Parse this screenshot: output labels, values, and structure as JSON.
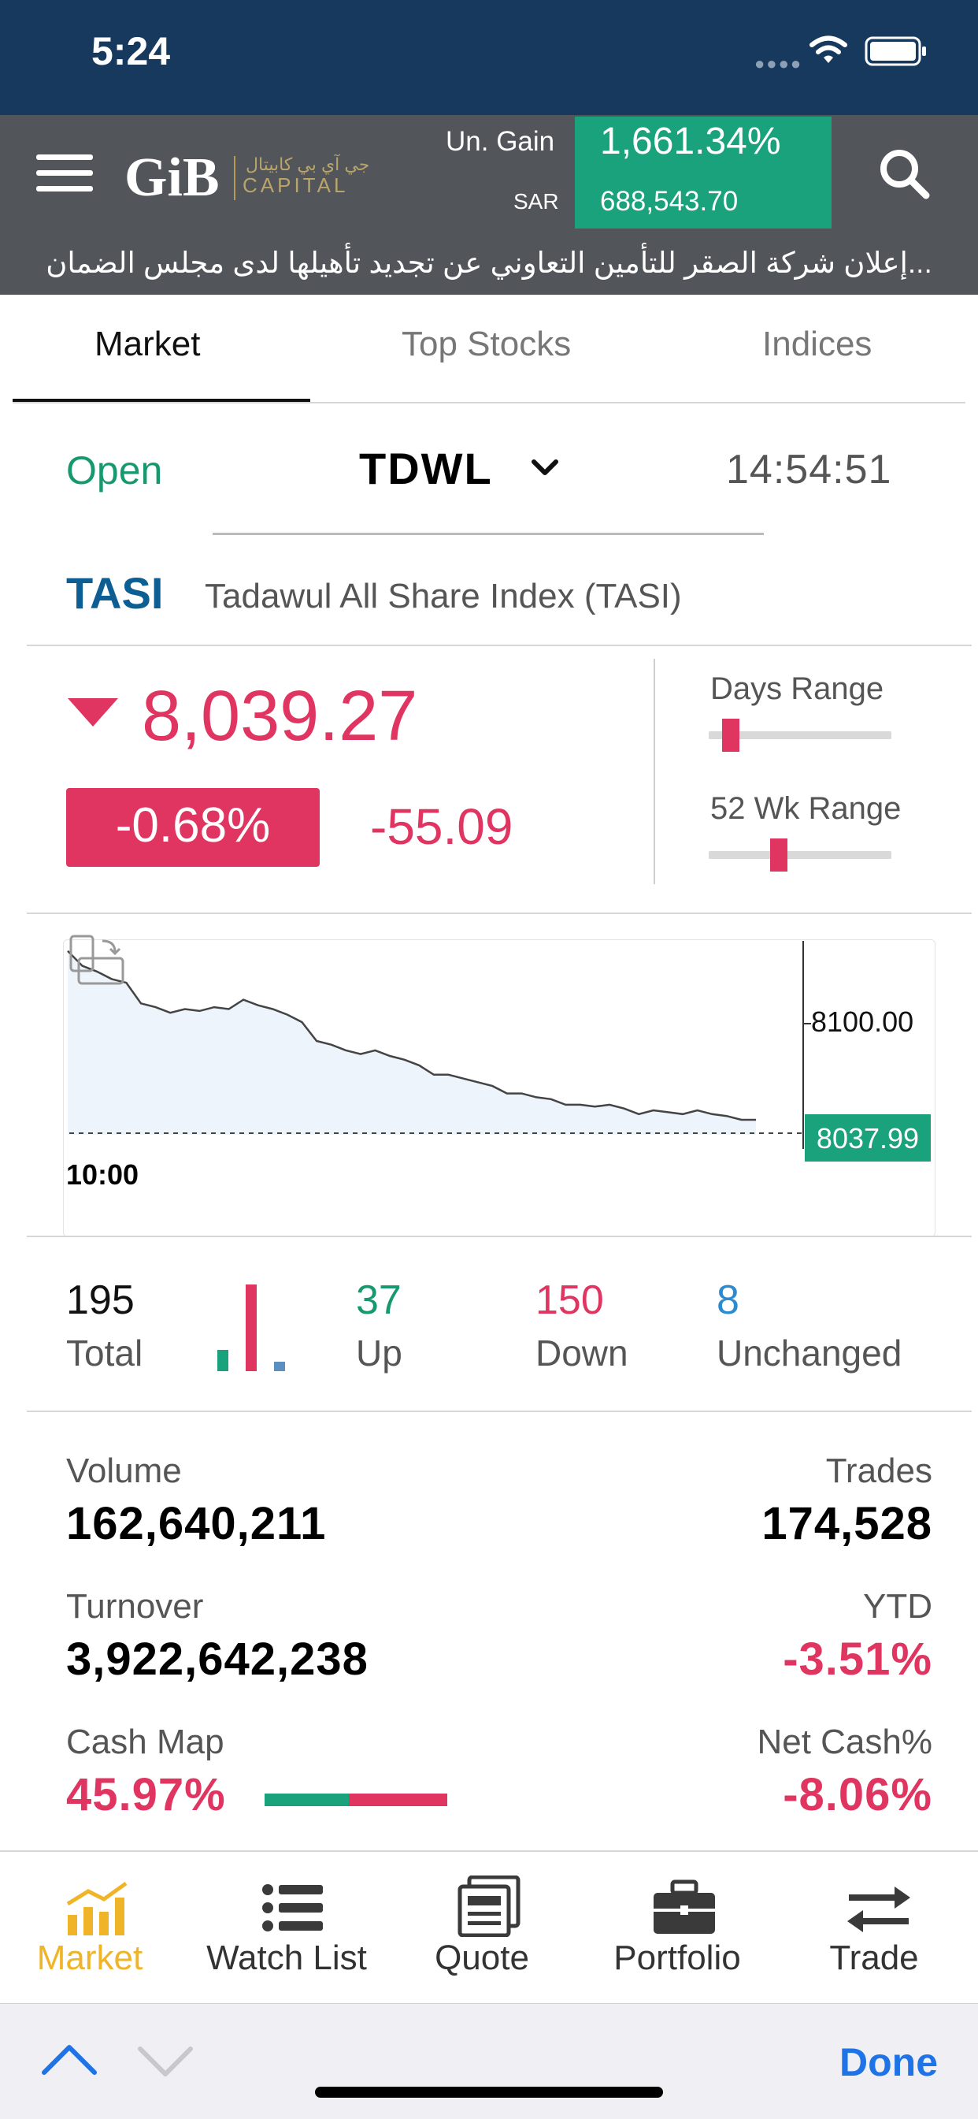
{
  "status_bar": {
    "time": "5:24"
  },
  "header": {
    "logo_text": "GiB",
    "logo_arabic": "جي آي بي كابيتال",
    "logo_capital": "CAPITAL",
    "ungain_label": "Un. Gain",
    "sar_label": "SAR",
    "gain_percent": "1,661.34%",
    "gain_value": "688,543.70",
    "ticker_text": "...إعلان شركة الصقر للتأمين التعاوني عن تجديد تأهيلها لدى مجلس الضمان"
  },
  "tabs": [
    {
      "label": "Market",
      "active": true
    },
    {
      "label": "Top Stocks",
      "active": false
    },
    {
      "label": "Indices",
      "active": false
    }
  ],
  "market": {
    "status": "Open",
    "exchange": "TDWL",
    "clock": "14:54:51"
  },
  "index": {
    "code": "TASI",
    "name": "Tadawul All Share Index (TASI)",
    "price": "8,039.27",
    "change_pct": "-0.68%",
    "change": "-55.09",
    "days_range_label": "Days Range",
    "wk52_range_label": "52 Wk Range",
    "days_range_position": 0.08,
    "wk52_range_position": 0.37
  },
  "chart": {
    "x_label_start": "10:00",
    "y_tick": "8100.00",
    "last_value": "8037.99"
  },
  "chart_data": {
    "type": "area",
    "x_start": "10:00",
    "y_reference": 8100.0,
    "last": 8037.99,
    "series": [
      {
        "values": [
          8128,
          8120,
          8117,
          8113,
          8111,
          8100,
          8098,
          8095,
          8097,
          8096,
          8098,
          8097,
          8102,
          8099,
          8097,
          8094,
          8090,
          8080,
          8078,
          8075,
          8073,
          8075,
          8072,
          8070,
          8067,
          8062,
          8062,
          8060,
          8058,
          8056,
          8052,
          8052,
          8050,
          8049,
          8046,
          8046,
          8045,
          8046,
          8044,
          8041,
          8043,
          8042,
          8041,
          8043,
          8041,
          8040,
          8038,
          8038
        ]
      }
    ]
  },
  "breadth": {
    "total": "195",
    "total_label": "Total",
    "up": "37",
    "up_label": "Up",
    "down": "150",
    "down_label": "Down",
    "unchanged": "8",
    "unchanged_label": "Unchanged",
    "counts": {
      "up": 37,
      "down": 150,
      "unchanged": 8
    }
  },
  "stats": {
    "volume_label": "Volume",
    "volume": "162,640,211",
    "trades_label": "Trades",
    "trades": "174,528",
    "turnover_label": "Turnover",
    "turnover": "3,922,642,238",
    "ytd_label": "YTD",
    "ytd": "-3.51%",
    "cashmap_label": "Cash Map",
    "cashmap": "45.97%",
    "netcash_label": "Net Cash%",
    "netcash": "-8.06%",
    "cashmap_fraction": 0.4597
  },
  "bottom_nav": [
    {
      "label": "Market",
      "icon": "chart-icon",
      "active": true
    },
    {
      "label": "Watch List",
      "icon": "list-icon",
      "active": false
    },
    {
      "label": "Quote",
      "icon": "quote-icon",
      "active": false
    },
    {
      "label": "Portfolio",
      "icon": "briefcase-icon",
      "active": false
    },
    {
      "label": "Trade",
      "icon": "arrows-icon",
      "active": false
    }
  ],
  "accessory": {
    "done_label": "Done"
  },
  "colors": {
    "red": "#e03560",
    "green": "#1aa27c",
    "blue": "#0d5e93",
    "nav_active": "#f0b428"
  }
}
